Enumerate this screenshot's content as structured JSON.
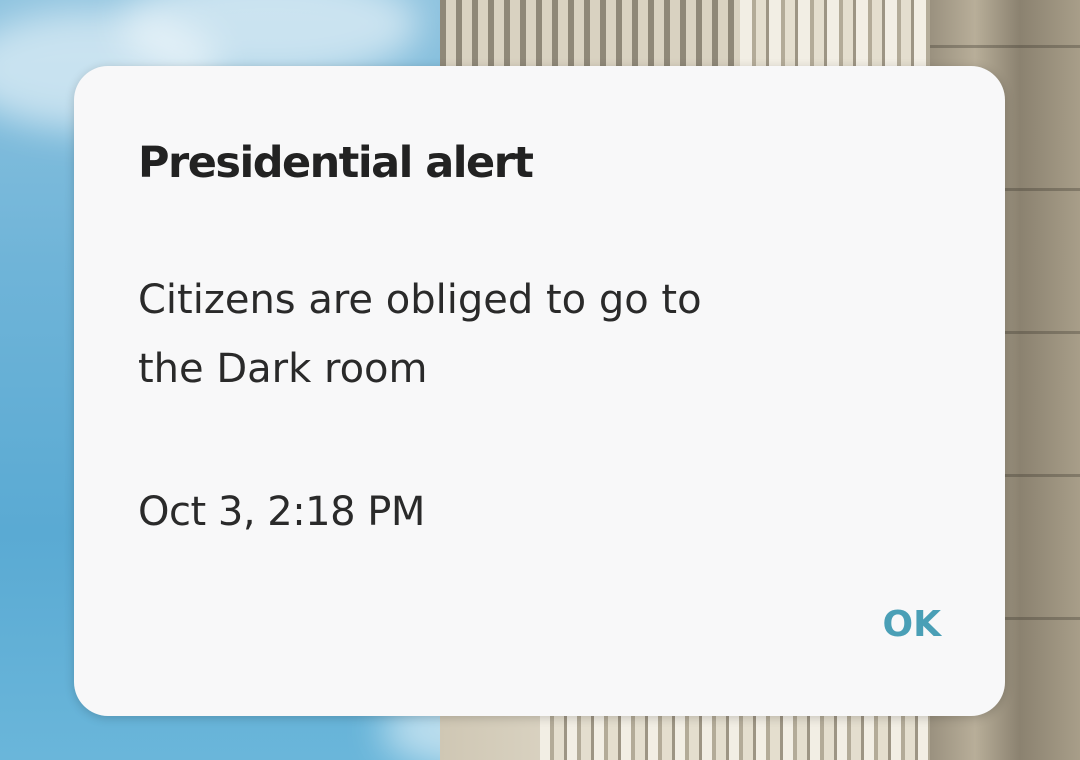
{
  "dialog": {
    "title": "Presidential alert",
    "message": "Citizens are obliged to go to the Dark room",
    "timestamp": "Oct 3, 2:18 PM",
    "ok_label": "OK"
  },
  "colors": {
    "dialog_background": "#f8f8f9",
    "button_accent": "#4a9fb6",
    "text": "#222222"
  }
}
